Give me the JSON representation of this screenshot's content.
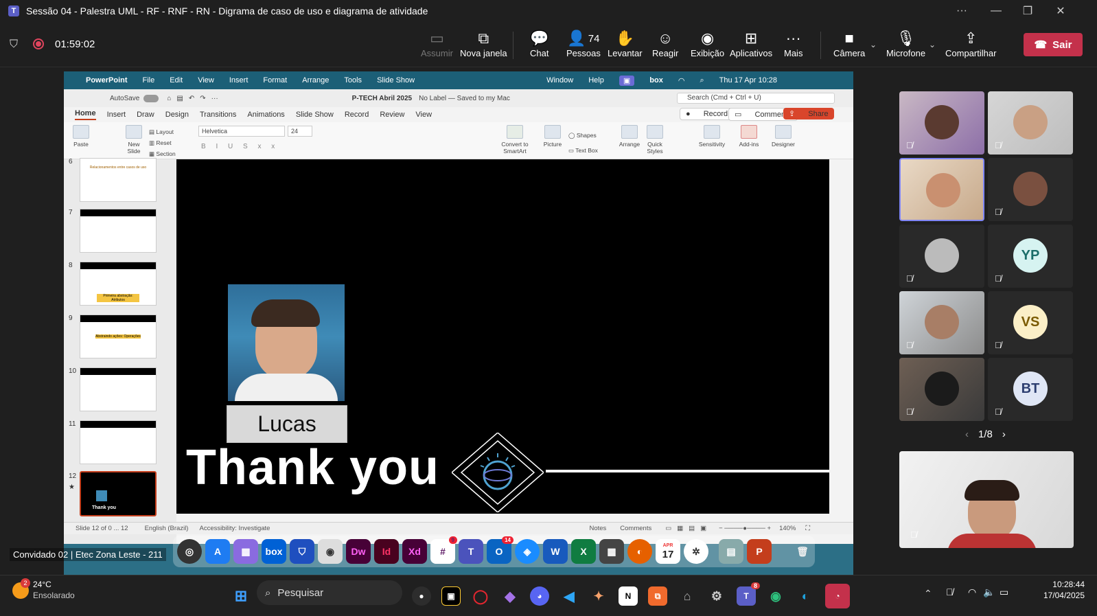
{
  "window": {
    "title": "Sessão 04 - Palestra UML - RF - RNF - RN - Digrama de caso de uso e diagrama de atividade"
  },
  "meeting": {
    "timer": "01:59:02",
    "people_count": "74",
    "chat_badge": "",
    "buttons": {
      "assumir": "Assumir",
      "nova_janela": "Nova janela",
      "chat": "Chat",
      "pessoas": "Pessoas",
      "levantar": "Levantar",
      "reagir": "Reagir",
      "exibicao": "Exibição",
      "aplicativos": "Aplicativos",
      "mais": "Mais",
      "camera": "Câmera",
      "microfone": "Microfone",
      "compartilhar": "Compartilhar",
      "sair": "Sair"
    }
  },
  "mac": {
    "menu": [
      "PowerPoint",
      "File",
      "Edit",
      "View",
      "Insert",
      "Format",
      "Arrange",
      "Tools",
      "Slide Show",
      "Window",
      "Help"
    ],
    "clock": "Thu 17 Apr  10:28",
    "box": "box"
  },
  "ppt": {
    "autosave": "AutoSave",
    "doc_title": "P-TECH Abril 2025",
    "label_status": "No Label — Saved to my Mac",
    "search_placeholder": "Search (Cmd + Ctrl + U)",
    "record": "Record",
    "comments": "Comments",
    "share": "Share",
    "tabs": [
      "Home",
      "Insert",
      "Draw",
      "Design",
      "Transitions",
      "Animations",
      "Slide Show",
      "Record",
      "Review",
      "View"
    ],
    "ribbon": {
      "paste": "Paste",
      "new_slide": "New Slide",
      "layout": "Layout",
      "reset": "Reset",
      "section": "Section",
      "font": "Helvetica",
      "size": "24",
      "convert": "Convert to SmartArt",
      "picture": "Picture",
      "shapes": "Shapes",
      "text_box": "Text Box",
      "arrange": "Arrange",
      "quick_styles": "Quick Styles",
      "sensitivity": "Sensitivity",
      "add_ins": "Add-ins",
      "designer": "Designer"
    },
    "thumbs": [
      {
        "num": "6",
        "text": "Relacionamentos entre casos de uso"
      },
      {
        "num": "7",
        "text": ""
      },
      {
        "num": "8",
        "text": "Primeira abstração: Atributos"
      },
      {
        "num": "9",
        "text": "Abstraindo ações: Operações"
      },
      {
        "num": "10",
        "text": ""
      },
      {
        "num": "11",
        "text": ""
      },
      {
        "num": "12",
        "text": "Thank you"
      }
    ],
    "slide": {
      "name": "Lucas",
      "thanks": "Thank you"
    },
    "status": {
      "slide": "Slide 12 of 0 ... 12",
      "lang": "English (Brazil)",
      "access": "Accessibility: Investigate",
      "notes": "Notes",
      "comments": "Comments",
      "zoom": "140%"
    }
  },
  "dock_badges": {
    "slack": "9",
    "outlook": "14",
    "calendar_month": "APR",
    "calendar_day": "17"
  },
  "dock_labels": {
    "box": "box",
    "dw": "Dw",
    "id": "Id",
    "xd": "Xd"
  },
  "guest_label": "Convidado 02 | Etec Zona Leste - 211",
  "participants": [
    {
      "initials": ""
    },
    {
      "initials": ""
    },
    {
      "initials": ""
    },
    {
      "initials": ""
    },
    {
      "initials": ""
    },
    {
      "initials": "YP"
    },
    {
      "initials": ""
    },
    {
      "initials": "VS"
    },
    {
      "initials": ""
    },
    {
      "initials": "BT"
    }
  ],
  "pager": "1/8",
  "taskbar": {
    "weather_temp": "24°C",
    "weather_desc": "Ensolarado",
    "weather_badge": "2",
    "search": "Pesquisar",
    "teams_badge": "8",
    "time": "10:28:44",
    "date": "17/04/2025"
  },
  "colors": {
    "teams_purple": "#5b5fc7",
    "sair_red": "#c4314b",
    "mac_teal": "#2c6f86",
    "ppt_accent": "#c43e1c"
  }
}
